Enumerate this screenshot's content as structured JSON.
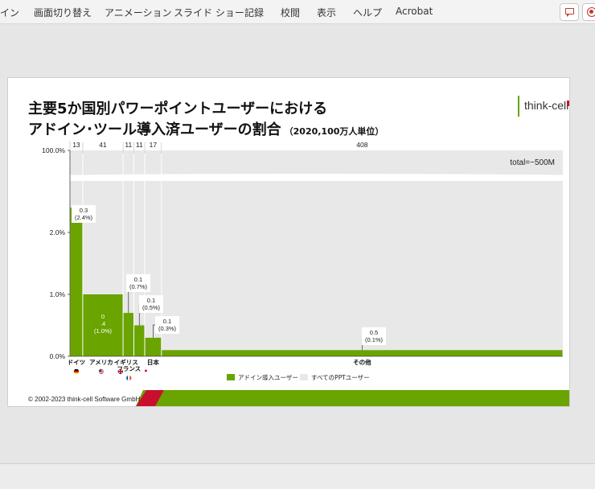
{
  "menu": {
    "items": [
      "イン",
      "画面切り替え",
      "アニメーション",
      "スライド ショー",
      "記録",
      "校閲",
      "表示",
      "ヘルプ",
      "Acrobat"
    ]
  },
  "slide": {
    "title_line1": "主要5か国別パワーポイントユーザーにおける",
    "title_line2": "アドイン･ツール導入済ユーザーの割合",
    "title_unit": "（2020,100万人単位）",
    "logo": "think-cell",
    "footer": "© 2002-2023 think-cell Software GmbH"
  },
  "colors": {
    "accent_green": "#6aa400",
    "total_gray": "#e8e8e8",
    "logo_red": "#c8102e"
  },
  "chart_data": {
    "type": "bar",
    "subtype": "mekko",
    "categories": [
      "ドイツ",
      "アメリカ",
      "イギリス",
      "フランス",
      "日本",
      "その他"
    ],
    "widths": [
      13,
      41,
      11,
      11,
      17,
      408
    ],
    "series": [
      {
        "name": "アドイン導入ユーザー",
        "values": [
          2.4,
          1.0,
          0.7,
          0.5,
          0.3,
          0.1
        ]
      },
      {
        "name": "すべてのPPTユーザー",
        "values": [
          100,
          100,
          100,
          100,
          100,
          100
        ]
      }
    ],
    "labels": [
      [
        "0.3",
        "(2.4%)"
      ],
      [
        "0",
        ".4",
        "(1.0%)"
      ],
      [
        "0.1",
        "(0.7%)"
      ],
      [
        "0.1",
        "(0.5%)"
      ],
      [
        "0.1",
        "(0.3%)"
      ],
      [
        "0.5",
        "(0.1%)"
      ]
    ],
    "y_ticks": [
      "0.0%",
      "1.0%",
      "2.0%",
      "100.0%"
    ],
    "annotation": "total=~500M",
    "flags": [
      "de",
      "us",
      "gb",
      "fr",
      "jp",
      ""
    ],
    "legend_position": "bottom"
  }
}
